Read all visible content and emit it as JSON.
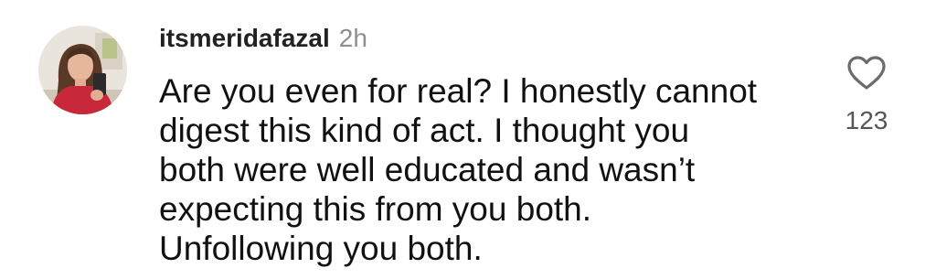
{
  "comment": {
    "username": "itsmeridafazal",
    "time": "2h",
    "text_lines": [
      "Are you even for real? I honestly cannot",
      "digest this kind of act. I thought you",
      "both were well educated and wasn’t",
      "expecting this from you both.",
      "Unfollowing you both."
    ],
    "like_count": "123",
    "icons": {
      "like": "heart-outline-icon",
      "avatar": "user-profile-photo"
    }
  }
}
